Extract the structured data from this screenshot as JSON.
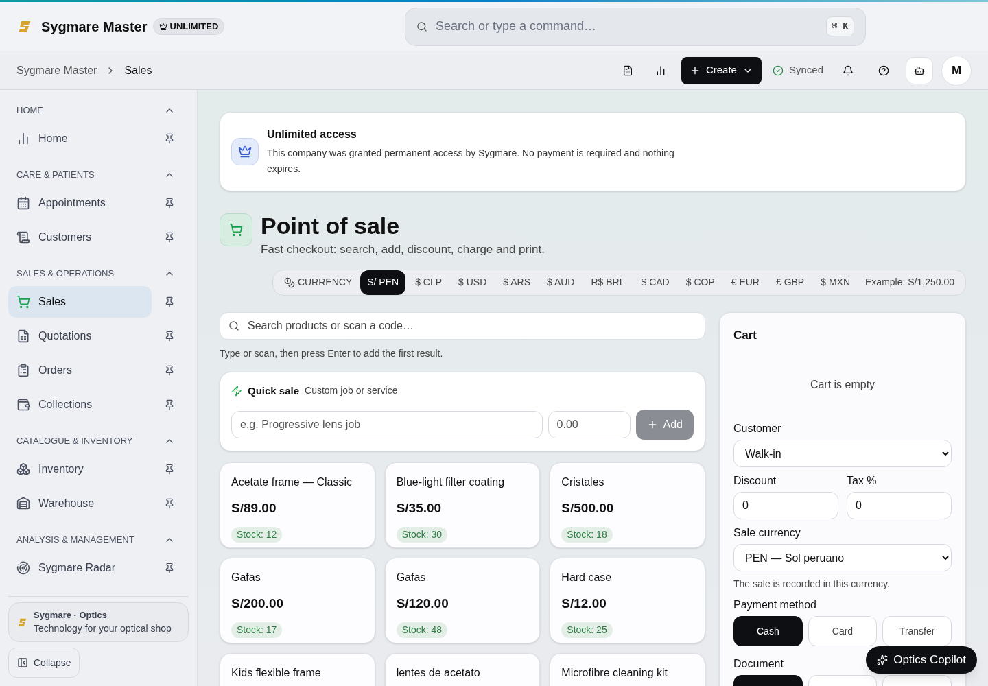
{
  "brand": {
    "name": "Sygmare Master",
    "badge": "UNLIMITED"
  },
  "command_search": {
    "placeholder": "Search or type a command…",
    "shortcut": "⌘ K"
  },
  "breadcrumb": [
    "Sygmare Master",
    "Sales"
  ],
  "toolbar": {
    "create": "Create",
    "sync_status": "Synced",
    "avatar": "M"
  },
  "sidebar": {
    "sections": [
      {
        "title": "HOME",
        "expanded": true,
        "items": [
          {
            "label": "Home",
            "selected": false
          }
        ]
      },
      {
        "title": "CARE & PATIENTS",
        "expanded": true,
        "items": [
          {
            "label": "Appointments",
            "selected": false
          },
          {
            "label": "Customers",
            "selected": false
          }
        ]
      },
      {
        "title": "SALES & OPERATIONS",
        "expanded": true,
        "items": [
          {
            "label": "Sales",
            "selected": true
          },
          {
            "label": "Quotations",
            "selected": false
          },
          {
            "label": "Orders",
            "selected": false
          },
          {
            "label": "Collections",
            "selected": false
          }
        ]
      },
      {
        "title": "CATALOGUE & INVENTORY",
        "expanded": true,
        "items": [
          {
            "label": "Inventory",
            "selected": false
          },
          {
            "label": "Warehouse",
            "selected": false
          }
        ]
      },
      {
        "title": "ANALYSIS & MANAGEMENT",
        "expanded": true,
        "items": [
          {
            "label": "Sygmare Radar",
            "selected": false
          }
        ]
      }
    ],
    "promo": {
      "title": "Sygmare · Optics",
      "subtitle": "Technology for your optical shop"
    },
    "collapse": "Collapse"
  },
  "notice": {
    "title": "Unlimited access",
    "text": "This company was granted permanent access by Sygmare. No payment is required and nothing expires."
  },
  "page": {
    "title": "Point of sale",
    "subtitle": "Fast checkout: search, add, discount, charge and print."
  },
  "currency_bar": {
    "label": "CURRENCY",
    "options": [
      {
        "label": "S/ PEN",
        "selected": true
      },
      {
        "label": "$ CLP",
        "selected": false
      },
      {
        "label": "$ USD",
        "selected": false
      },
      {
        "label": "$ ARS",
        "selected": false
      },
      {
        "label": "$ AUD",
        "selected": false
      },
      {
        "label": "R$ BRL",
        "selected": false
      },
      {
        "label": "$ CAD",
        "selected": false
      },
      {
        "label": "$ COP",
        "selected": false
      },
      {
        "label": "€ EUR",
        "selected": false
      },
      {
        "label": "£ GBP",
        "selected": false
      },
      {
        "label": "$ MXN",
        "selected": false
      }
    ],
    "example": "Example: S/1,250.00"
  },
  "product_search": {
    "placeholder": "Search products or scan a code…",
    "hint": "Type or scan, then press Enter to add the first result."
  },
  "quick_sale": {
    "title": "Quick sale",
    "subtitle": "Custom job or service",
    "name_placeholder": "e.g. Progressive lens job",
    "price_placeholder": "0.00",
    "add": "Add",
    "add_disabled": true
  },
  "products": [
    {
      "name": "Acetate frame — Classic",
      "price": "S/89.00",
      "stock": "Stock: 12"
    },
    {
      "name": "Blue-light filter coating",
      "price": "S/35.00",
      "stock": "Stock: 30"
    },
    {
      "name": "Cristales",
      "price": "S/500.00",
      "stock": "Stock: 18"
    },
    {
      "name": "Gafas",
      "price": "S/200.00",
      "stock": "Stock: 17"
    },
    {
      "name": "Gafas",
      "price": "S/120.00",
      "stock": "Stock: 48"
    },
    {
      "name": "Hard case",
      "price": "S/12.00",
      "stock": "Stock: 25"
    },
    {
      "name": "Kids flexible frame"
    },
    {
      "name": "lentes de acetato"
    },
    {
      "name": "Microfibre cleaning kit"
    }
  ],
  "cart": {
    "title": "Cart",
    "empty": "Cart is empty",
    "customer_label": "Customer",
    "customer": "Walk-in",
    "discount_label": "Discount",
    "discount": "0",
    "tax_label": "Tax %",
    "tax": "0",
    "currency_label": "Sale currency",
    "currency": "PEN — Sol peruano",
    "currency_hint": "The sale is recorded in this currency.",
    "payment_label": "Payment method",
    "payment_methods": [
      {
        "label": "Cash",
        "selected": true
      },
      {
        "label": "Card",
        "selected": false
      },
      {
        "label": "Transfer",
        "selected": false
      }
    ],
    "document_label": "Document",
    "documents": [
      {
        "selected": true
      },
      {
        "selected": false
      },
      {
        "selected": false
      }
    ]
  },
  "copilot": "Optics Copilot"
}
